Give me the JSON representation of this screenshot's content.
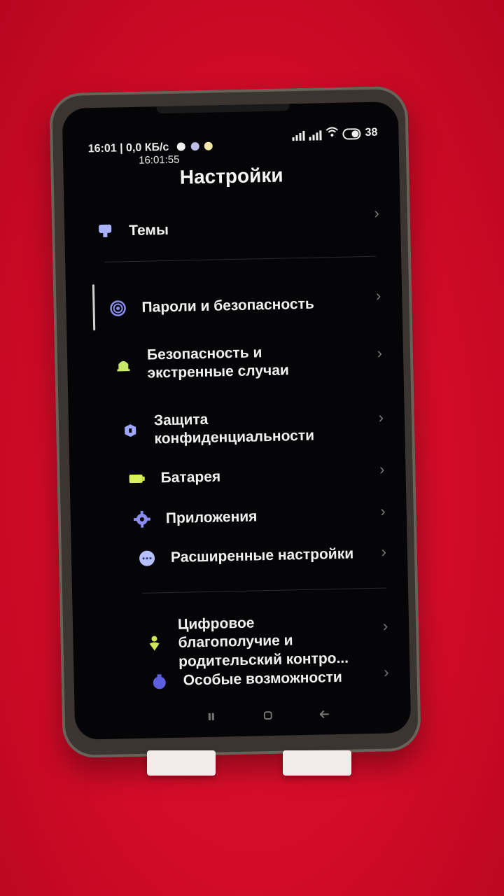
{
  "status_bar": {
    "left_text": "16:01 | 0,0 КБ/с",
    "clock": "16:01:55",
    "battery": "38"
  },
  "page": {
    "title": "Настройки"
  },
  "items": [
    {
      "label": "Темы",
      "icon": "theme-icon"
    },
    {
      "label": "Пароли и безопасность",
      "icon": "fingerprint-icon"
    },
    {
      "label": "Безопасность и экстренные случаи",
      "icon": "bell-icon"
    },
    {
      "label": "Защита конфиденциальности",
      "icon": "privacy-shield-icon"
    },
    {
      "label": "Батарея",
      "icon": "battery-icon"
    },
    {
      "label": "Приложения",
      "icon": "gear-icon"
    },
    {
      "label": "Расширенные настройки",
      "icon": "more-dots-icon"
    },
    {
      "label": "Цифровое благополучие и родительский контро...",
      "icon": "wellbeing-icon"
    },
    {
      "label": "Особые возможности",
      "icon": "accessibility-icon"
    }
  ],
  "colors": {
    "background": "#d20b28",
    "screen": "#050507",
    "accent": "#8a8cf0"
  }
}
